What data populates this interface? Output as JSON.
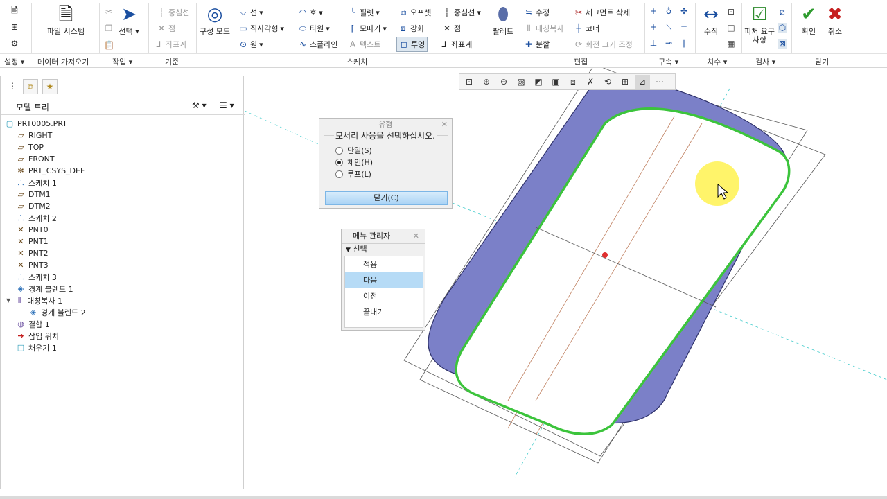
{
  "ribbon": {
    "groups": [
      "설정",
      "데이터 가져오기",
      "작업",
      "기준",
      "스케치",
      "편집",
      "구속",
      "치수",
      "검사",
      "닫기"
    ],
    "file_system": "파일 시스템",
    "select": "선택",
    "datum": {
      "centerline": "중심선",
      "point": "점",
      "csys": "좌표계"
    },
    "construction_mode": "구성 모드",
    "sketch": {
      "line": "선",
      "rectangle": "직사각형",
      "circle": "원",
      "arc": "호",
      "ellipse": "타원",
      "spline": "스플라인",
      "fillet": "필렛",
      "chamfer": "모따기",
      "text": "텍스트",
      "offset": "오프셋",
      "thicken": "강화",
      "project": "투영",
      "centerline": "중심선",
      "point": "점",
      "csys": "좌표계",
      "palette": "팔레트"
    },
    "edit": {
      "modify": "수정",
      "mirror": "대칭복사",
      "divide": "분할",
      "delete_segment": "세그먼트 삭제",
      "corner": "코너",
      "rotate_resize": "회전 크기 조정"
    },
    "dimension": {
      "normal": "수직"
    },
    "inspect": {
      "feature_requirements": "피처 요구사항"
    },
    "close": {
      "ok": "확인",
      "cancel": "취소"
    }
  },
  "model_tree": {
    "header": "모델 트리",
    "items": [
      {
        "label": "PRT0005.PRT",
        "icon": "part-icon",
        "indent": 0
      },
      {
        "label": "RIGHT",
        "icon": "datum-plane-icon",
        "indent": 1
      },
      {
        "label": "TOP",
        "icon": "datum-plane-icon",
        "indent": 1
      },
      {
        "label": "FRONT",
        "icon": "datum-plane-icon",
        "indent": 1
      },
      {
        "label": "PRT_CSYS_DEF",
        "icon": "csys-icon",
        "indent": 1
      },
      {
        "label": "스케치 1",
        "icon": "sketch-icon",
        "indent": 1
      },
      {
        "label": "DTM1",
        "icon": "datum-plane-icon",
        "indent": 1
      },
      {
        "label": "DTM2",
        "icon": "datum-plane-icon",
        "indent": 1
      },
      {
        "label": "스케치 2",
        "icon": "sketch-icon",
        "indent": 1
      },
      {
        "label": "PNT0",
        "icon": "datum-point-icon",
        "indent": 1
      },
      {
        "label": "PNT1",
        "icon": "datum-point-icon",
        "indent": 1
      },
      {
        "label": "PNT2",
        "icon": "datum-point-icon",
        "indent": 1
      },
      {
        "label": "PNT3",
        "icon": "datum-point-icon",
        "indent": 1
      },
      {
        "label": "스케치 3",
        "icon": "sketch-icon",
        "indent": 1
      },
      {
        "label": "경계 블렌드 1",
        "icon": "boundary-blend-icon",
        "indent": 1
      },
      {
        "label": "대칭복사 1",
        "icon": "mirror-icon",
        "indent": 1,
        "expanded": true
      },
      {
        "label": "경계 블렌드 2",
        "icon": "boundary-blend-icon",
        "indent": 2
      },
      {
        "label": "결합 1",
        "icon": "merge-icon",
        "indent": 1
      },
      {
        "label": "삽입 위치",
        "icon": "insert-here-icon",
        "indent": 1
      },
      {
        "label": "채우기 1",
        "icon": "fill-icon",
        "indent": 1
      }
    ]
  },
  "type_dialog": {
    "title": "유형",
    "prompt": "모서리 사용을 선택하십시오.",
    "options": [
      "단일(S)",
      "체인(H)",
      "루프(L)"
    ],
    "selected": "체인(H)",
    "close_button": "닫기(C)"
  },
  "menu_manager": {
    "title": "메뉴 관리자",
    "section": "선택",
    "items": [
      "적용",
      "다음",
      "이전",
      "끝내기"
    ],
    "selected": "다음"
  },
  "colors": {
    "surface": "#7b80c8",
    "edge_chain": "#3cc43c",
    "highlight_cursor": "#fff35a"
  }
}
